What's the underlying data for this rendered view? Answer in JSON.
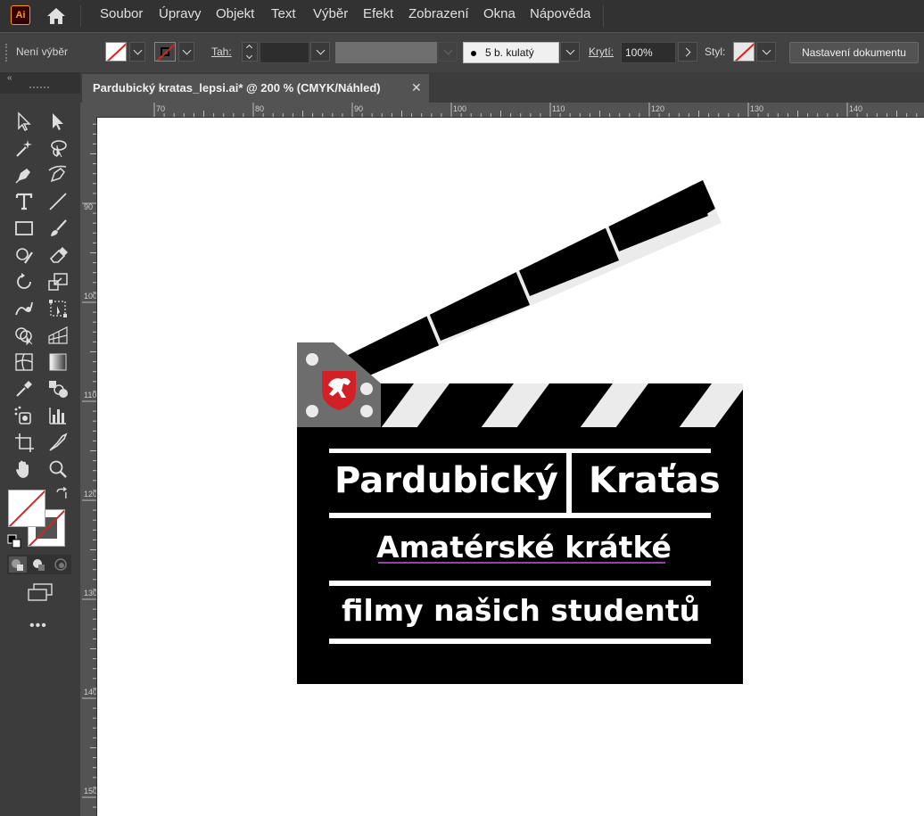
{
  "app": {
    "logo_text": "Ai",
    "accent_color": "#ff9a00"
  },
  "menu": {
    "items": [
      "Soubor",
      "Úpravy",
      "Objekt",
      "Text",
      "Výběr",
      "Efekt",
      "Zobrazení",
      "Okna",
      "Nápověda"
    ]
  },
  "control_bar": {
    "selection_label": "Není výběr",
    "stroke_label": "Tah:",
    "brush_value": "5 b. kulatý",
    "opacity_label": "Krytí:",
    "opacity_value": "100%",
    "style_label": "Styl:",
    "doc_settings_button": "Nastavení dokumentu"
  },
  "document_tab": {
    "title": "Pardubický kratas_lepsi.ai* @ 200 % (CMYK/Náhled)",
    "close_icon": "close-icon"
  },
  "rulers": {
    "horizontal": [
      "70",
      "80",
      "90",
      "100",
      "110",
      "120",
      "130",
      "140"
    ],
    "vertical": [
      "90",
      "100",
      "110",
      "120",
      "130",
      "140",
      "150"
    ]
  },
  "toolbar": {
    "tools": [
      "selection-tool-icon",
      "direct-selection-tool-icon",
      "magic-wand-tool-icon",
      "lasso-tool-icon",
      "pen-tool-icon",
      "curvature-tool-icon",
      "type-tool-icon",
      "line-tool-icon",
      "rectangle-tool-icon",
      "paintbrush-tool-icon",
      "shaper-tool-icon",
      "eraser-tool-icon",
      "rotate-tool-icon",
      "scale-tool-icon",
      "warp-tool-icon",
      "free-transform-tool-icon",
      "shape-builder-tool-icon",
      "perspective-grid-tool-icon",
      "mesh-tool-icon",
      "gradient-tool-icon",
      "eyedropper-tool-icon",
      "blend-tool-icon",
      "symbol-sprayer-tool-icon",
      "column-graph-tool-icon",
      "artboard-tool-icon",
      "slice-tool-icon",
      "hand-tool-icon",
      "zoom-tool-icon"
    ],
    "more_label": "•••"
  },
  "artwork": {
    "line1_left": "Pardubický",
    "line1_right": "Kraťas",
    "line2": "Amatérské krátké",
    "line3": "filmy našich studentů",
    "colors": {
      "board": "#000000",
      "stripe_light": "#ebebeb",
      "hinge": "#6d6d6d",
      "crest": "#d32027"
    }
  }
}
